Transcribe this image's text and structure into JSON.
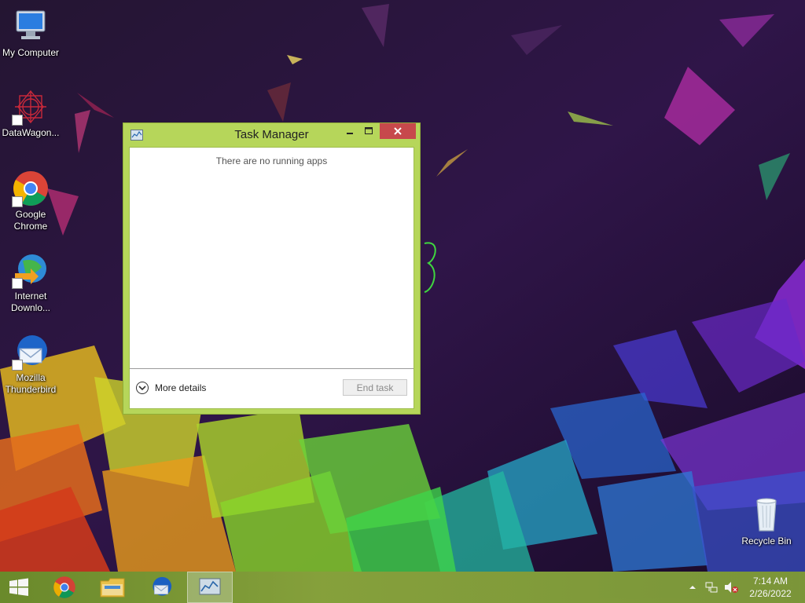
{
  "desktop": {
    "icons": [
      {
        "label": "My Computer",
        "icon": "computer-icon"
      },
      {
        "label": "DataWagon...",
        "icon": "datawagon-icon"
      },
      {
        "label": "Google Chrome",
        "icon": "chrome-icon"
      },
      {
        "label": "Internet Downlo...",
        "icon": "idm-icon"
      },
      {
        "label": "Mozilla Thunderbird",
        "icon": "thunderbird-icon"
      },
      {
        "label": "Recycle Bin",
        "icon": "recycle-bin-icon"
      }
    ]
  },
  "task_manager": {
    "title": "Task Manager",
    "empty_message": "There are no running apps",
    "more_details": "More details",
    "end_task": "End task",
    "controls": {
      "minimize": "minimize-icon",
      "maximize": "maximize-icon",
      "close": "close-icon"
    }
  },
  "taskbar": {
    "pinned": [
      {
        "name": "start-button",
        "icon": "windows-logo-icon"
      },
      {
        "name": "chrome",
        "icon": "chrome-icon"
      },
      {
        "name": "file-explorer",
        "icon": "folder-icon"
      },
      {
        "name": "thunderbird",
        "icon": "thunderbird-icon"
      },
      {
        "name": "task-manager",
        "icon": "task-manager-icon",
        "active": true
      }
    ],
    "tray": {
      "icons": [
        "show-hidden-icons-chevron",
        "network-icon",
        "volume-muted-icon"
      ]
    },
    "clock": {
      "time": "7:14 AM",
      "date": "2/26/2022"
    }
  },
  "colors": {
    "window_frame": "#b6d65a",
    "close_button": "#c7494c",
    "taskbar": "#7f9b3a"
  }
}
